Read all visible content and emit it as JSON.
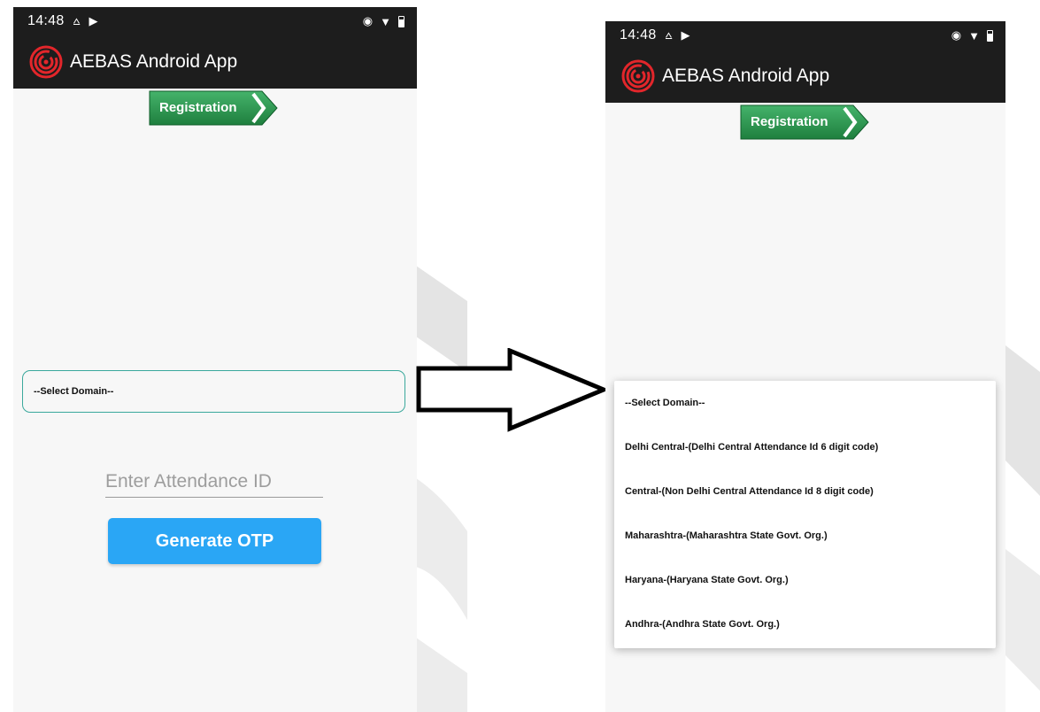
{
  "status_bar": {
    "time": "14:48"
  },
  "app": {
    "title": "AEBAS Android App"
  },
  "registration": {
    "label": "Registration"
  },
  "form": {
    "domain_select_value": "--Select Domain--",
    "attendance_placeholder": "Enter Attendance ID",
    "otp_button_label": "Generate OTP"
  },
  "dropdown": {
    "options": [
      "--Select Domain--",
      "Delhi Central-(Delhi Central Attendance Id 6 digit code)",
      "Central-(Non Delhi Central Attendance Id 8 digit code)",
      "Maharashtra-(Maharashtra State Govt. Org.)",
      "Haryana-(Haryana State Govt. Org.)",
      "Andhra-(Andhra State Govt. Org.)"
    ]
  },
  "colors": {
    "toolbar": "#1d1d1d",
    "accent_button": "#2aa6f5",
    "registration_green": "#2e9b54",
    "select_border": "#3aa89c",
    "logo_red": "#e3262b"
  }
}
